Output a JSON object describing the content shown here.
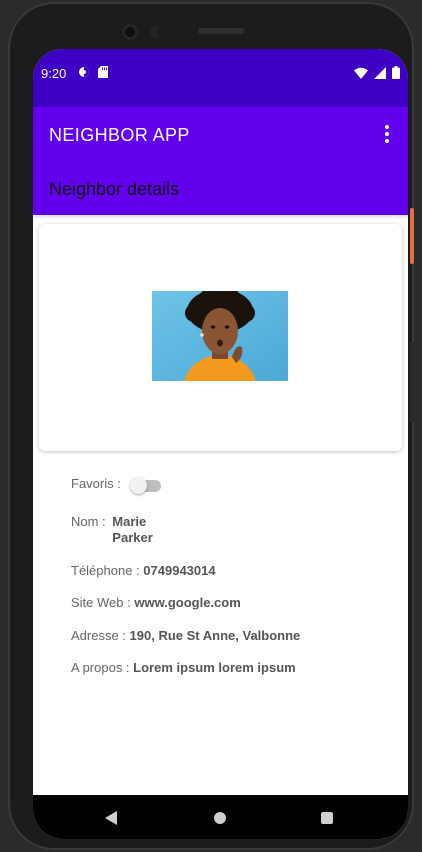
{
  "status_bar": {
    "time": "9:20"
  },
  "app_bar": {
    "title": "NEIGHBOR APP"
  },
  "sub_bar": {
    "title": "Neighbor details"
  },
  "details": {
    "favorite_label": "Favoris :",
    "favorite_on": false,
    "name_label": "Nom :",
    "first_name": "Marie",
    "last_name": "Parker",
    "phone_label": "Téléphone :",
    "phone": "0749943014",
    "website_label": "Site Web :",
    "website": "www.google.com",
    "address_label": "Adresse :",
    "address": "190, Rue St Anne, Valbonne",
    "about_label": "A propos :",
    "about": "Lorem ipsum lorem ipsum"
  },
  "colors": {
    "status_bar": "#3d00c4",
    "primary": "#6200ee"
  }
}
